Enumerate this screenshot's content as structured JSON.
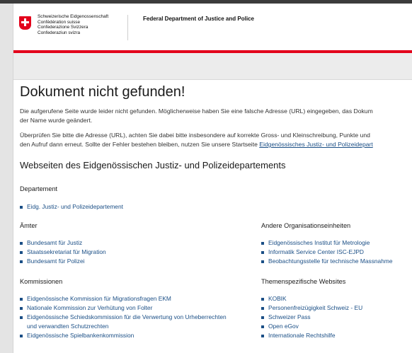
{
  "header": {
    "lang_lines": [
      "Schweizerische Eidgenossenschaft",
      "Confédération suisse",
      "Confederazione Svizzera",
      "Confederaziun svizra"
    ],
    "department": "Federal Department of Justice and Police"
  },
  "main": {
    "title": "Dokument nicht gefunden!",
    "p1_line1": "Die aufgerufene Seite wurde leider nicht gefunden. Möglicherweise haben Sie eine falsche Adresse (URL) eingegeben, das Dokum",
    "p1_line2": "der Name wurde geändert.",
    "p2_line1": "Überprüfen Sie bitte die Adresse (URL), achten Sie dabei bitte insbesondere auf korrekte Gross- und Kleinschreibung, Punkte und",
    "p2_line2_prefix": "den Aufruf dann erneut. Sollte der Fehler bestehen bleiben, nutzen Sie unsere Startseite ",
    "p2_link": "Eidgenössisches Justiz- und Polizeidepart",
    "subtitle": "Webseiten des Eidgenössischen Justiz- und Polizeidepartements"
  },
  "sections": {
    "departement": {
      "title": "Departement",
      "links": [
        "Eidg. Justiz- und Polizeidepartement"
      ]
    },
    "aemter": {
      "title": "Ämter",
      "links": [
        "Bundesamt für Justiz",
        "Staatssekretariat für Migration",
        "Bundesamt für Polizei"
      ]
    },
    "kommissionen": {
      "title": "Kommissionen",
      "links": [
        "Eidgenössische Kommission für Migrationsfragen EKM",
        "Nationale Kommission zur Verhütung von Folter",
        "Eidgenössische Schiedskommission für die Verwertung von Urheberrechten",
        "Eidgenössische Spielbankenkommission"
      ],
      "link3_line2": "und verwandten Schutzrechten"
    },
    "andere": {
      "title": "Andere Organisationseinheiten",
      "links": [
        "Eidgenössisches Institut für Metrologie",
        "Informatik Service Center ISC-EJPD",
        "Beobachtungsstelle für technische Massnahme"
      ]
    },
    "themen": {
      "title": "Themenspezifische Websites",
      "links": [
        "KOBIK",
        "Personenfreizügigkeit Schweiz - EU",
        "Schweizer Pass",
        "Open eGov",
        "Internationale Rechtshilfe"
      ]
    }
  }
}
